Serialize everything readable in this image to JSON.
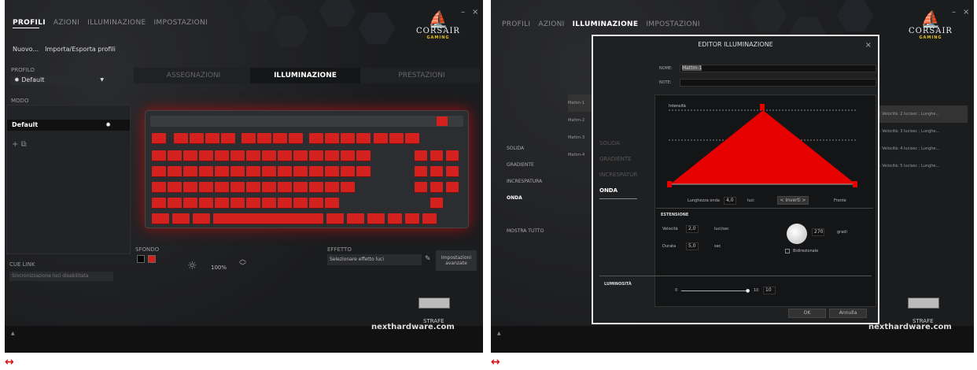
{
  "left": {
    "nav": [
      "PROFILI",
      "AZIONI",
      "ILLUMINAZIONE",
      "IMPOSTAZIONI"
    ],
    "nav_active": 0,
    "window_controls": {
      "minimize": "–",
      "close": "×"
    },
    "logo": {
      "brand": "CORSAIR",
      "sub": "GAMING"
    },
    "submenu": {
      "new": "Nuovo...",
      "import_export": "Importa/Esporta profili"
    },
    "profile": {
      "label": "PROFILO",
      "value": "Default"
    },
    "mode": {
      "label": "MODO",
      "value": "Default"
    },
    "cue_link": {
      "label": "CUE LINK",
      "value": "Sincronizzazione luci disabilitata"
    },
    "tabs": [
      "ASSEGNAZIONI",
      "ILLUMINAZIONE",
      "PRESTAZIONI"
    ],
    "tab_active": 1,
    "sfondo_label": "SFONDO",
    "brightness": "100%",
    "effetto": {
      "label": "EFFETTO",
      "value": "Selezionare effetto luci"
    },
    "advanced_button": "Impostazioni avanzate",
    "device": "STRAFE",
    "watermark": "nexthardware.com",
    "accent": "#d4211e"
  },
  "right": {
    "nav": [
      "PROFILI",
      "AZIONI",
      "ILLUMINAZIONE",
      "IMPOSTAZIONI"
    ],
    "nav_active": 2,
    "logo": {
      "brand": "CORSAIR",
      "sub": "GAMING"
    },
    "side_list": [
      "SOLIDA",
      "GRADIENTE",
      "INCRESPATURA",
      "ONDA",
      "MOSTRA TUTTO"
    ],
    "side_active": 3,
    "bg_rows": [
      "Mattm-1",
      "Mattm-2",
      "Mattm-3",
      "Mattm-4"
    ],
    "bg_right_rows": [
      ": Velocità: 2 lucisec ; Lunghe...",
      ": Velocità: 3 lucisec ; Lunghe...",
      ": Velocità: 4 lucisec ; Lunghe...",
      ": Velocità: 5 lucisec ; Lunghe..."
    ],
    "dialog": {
      "title": "EDITOR ILLUMINAZIONE",
      "close": "×",
      "nome_label": "NOME:",
      "nome_value": "Mattm-1",
      "note_label": "NOTE:",
      "menu": [
        "SOLIDA",
        "GRADIENTE",
        "INCRESPATUR",
        "ONDA"
      ],
      "menu_active": 3,
      "graph_label": "Intensità",
      "wave_length_label": "Lunghezza onda",
      "wave_length_value": "4,0",
      "wave_length_unit": "luci",
      "invert_button": "< Inverti >",
      "front_label": "Fronte",
      "extension_label": "ESTENSIONE",
      "speed_label": "Velocità",
      "speed_value": "2,0",
      "speed_unit": "luci/sec",
      "duration_label": "Durata",
      "duration_value": "5,0",
      "duration_unit": "sec",
      "angle_value": "270",
      "angle_unit": "gradi",
      "bidirectional_label": "Bidirezionale",
      "brightness_label": "LUMINOSITÀ",
      "brightness_min": "0",
      "brightness_max": "10",
      "brightness_value": "10",
      "ok_button": "OK",
      "cancel_button": "Annulla"
    },
    "device": "STRAFE",
    "watermark": "nexthardware.com"
  },
  "arrows": [
    "↔",
    "↔"
  ],
  "accent": "#e60000"
}
